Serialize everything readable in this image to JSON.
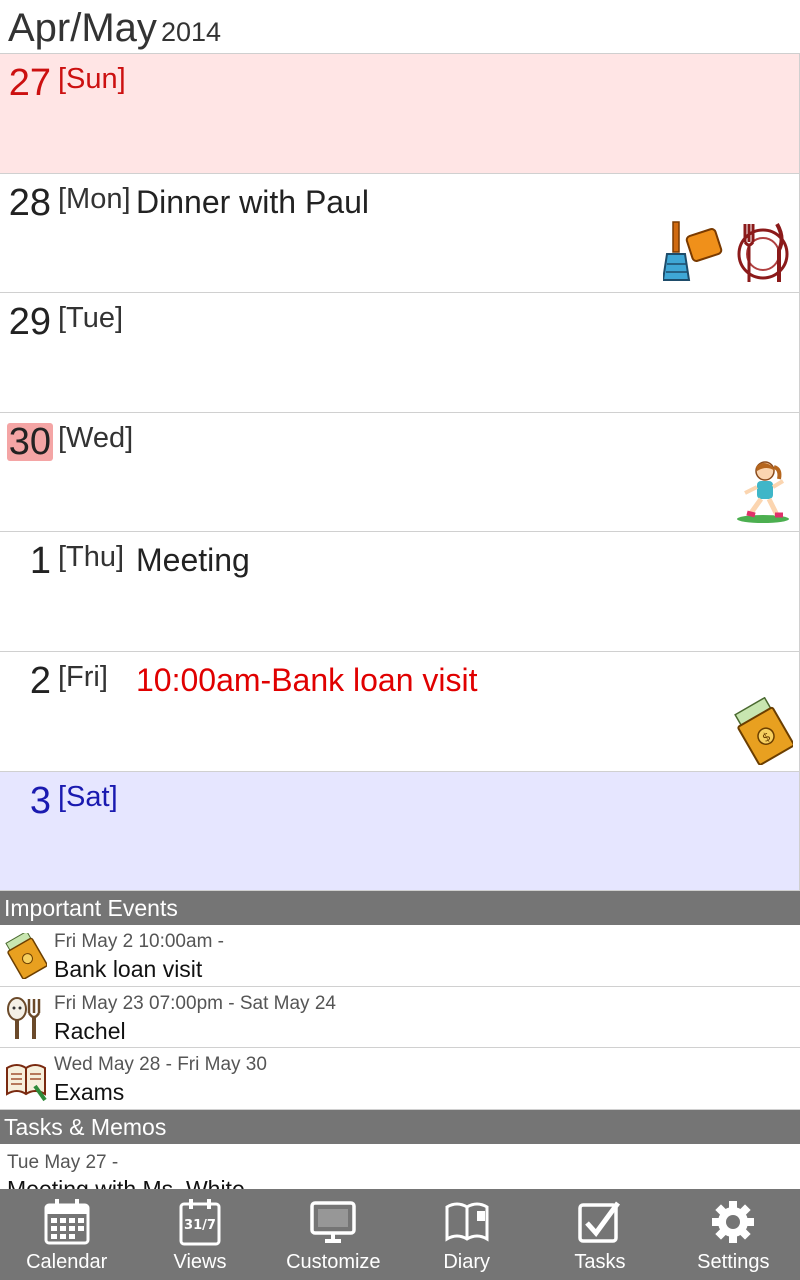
{
  "header": {
    "month": "Apr/May",
    "year": "2014"
  },
  "days": [
    {
      "num": "27",
      "dow": "[Sun]",
      "event": ""
    },
    {
      "num": "28",
      "dow": "[Mon]",
      "event": "Dinner with Paul"
    },
    {
      "num": "29",
      "dow": "[Tue]",
      "event": ""
    },
    {
      "num": "30",
      "dow": "[Wed]",
      "event": ""
    },
    {
      "num": "1",
      "dow": "[Thu]",
      "event": "Meeting"
    },
    {
      "num": "2",
      "dow": "[Fri]",
      "event": "10:00am-Bank loan visit"
    },
    {
      "num": "3",
      "dow": "[Sat]",
      "event": ""
    }
  ],
  "stickers": {
    "mon": [
      "broom-dustpan-icon",
      "fork-knife-plate-icon"
    ],
    "wed": [
      "running-girl-icon"
    ],
    "fri": [
      "money-envelope-icon"
    ]
  },
  "important_events": {
    "title": "Important Events",
    "items": [
      {
        "icon": "money-envelope-icon",
        "date": "Fri May 2 10:00am -",
        "title": "Bank loan visit"
      },
      {
        "icon": "spoon-fork-icon",
        "date": "Fri May 23 07:00pm - Sat May 24",
        "title": "Rachel"
      },
      {
        "icon": "open-book-icon",
        "date": "Wed May 28  - Fri May 30",
        "title": "Exams"
      }
    ]
  },
  "tasks": {
    "title": "Tasks & Memos",
    "items": [
      {
        "date": "Tue May 27 -",
        "title": "Meeting with Ms. White"
      }
    ]
  },
  "nav": [
    {
      "label": "Calendar",
      "icon": "calendar-icon"
    },
    {
      "label": "Views",
      "icon": "views-calendar-icon"
    },
    {
      "label": "Customize",
      "icon": "monitor-icon"
    },
    {
      "label": "Diary",
      "icon": "diary-book-icon"
    },
    {
      "label": "Tasks",
      "icon": "checkbox-icon"
    },
    {
      "label": "Settings",
      "icon": "gear-icon"
    }
  ],
  "colors": {
    "sunday": "#cc1010",
    "saturday": "#1a1ab0",
    "today": "#f4a5a5",
    "bar": "#757575",
    "important_event": "#e00000"
  }
}
